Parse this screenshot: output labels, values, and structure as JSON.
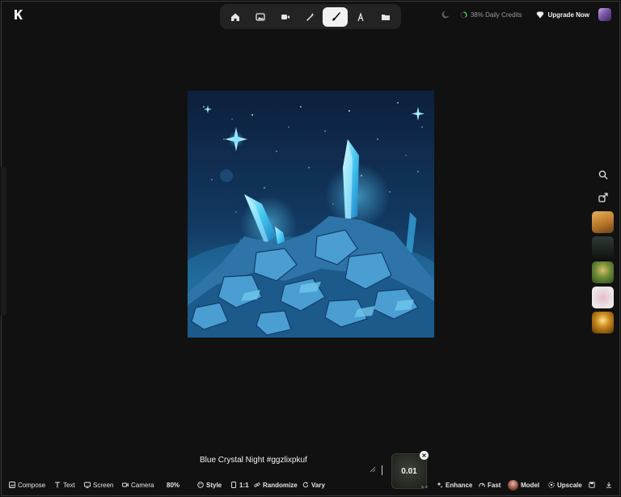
{
  "toolbar": {
    "tools": [
      {
        "name": "home",
        "icon": "home-icon",
        "active": false
      },
      {
        "name": "image",
        "icon": "image-icon",
        "active": false
      },
      {
        "name": "video",
        "icon": "video-icon",
        "active": false
      },
      {
        "name": "wand",
        "icon": "magic-wand-icon",
        "active": false
      },
      {
        "name": "brush",
        "icon": "brush-icon",
        "active": true
      },
      {
        "name": "text",
        "icon": "text-tool-icon",
        "active": false
      },
      {
        "name": "folder",
        "icon": "folder-icon",
        "active": false
      }
    ]
  },
  "header": {
    "credits_label": "38% Daily Credits",
    "credits_percent": 38,
    "upgrade_label": "Upgrade Now"
  },
  "colors": {
    "accent_green": "#3ecf5a",
    "background": "#111111",
    "toolbar_bg": "#232323"
  },
  "prompt": {
    "text": "Blue Crystal Night #ggzlixpkuf"
  },
  "counter": {
    "value": "0.01"
  },
  "bottom_bar": {
    "compose": "Compose",
    "text": "Text",
    "screen": "Screen",
    "camera": "Camera",
    "zoom": "80%",
    "style": "Style",
    "ratio": "1:1",
    "randomize": "Randomize",
    "vary": "Vary",
    "enhance": "Enhance",
    "fast": "Fast",
    "model": "Model",
    "upscale": "Upscale"
  }
}
